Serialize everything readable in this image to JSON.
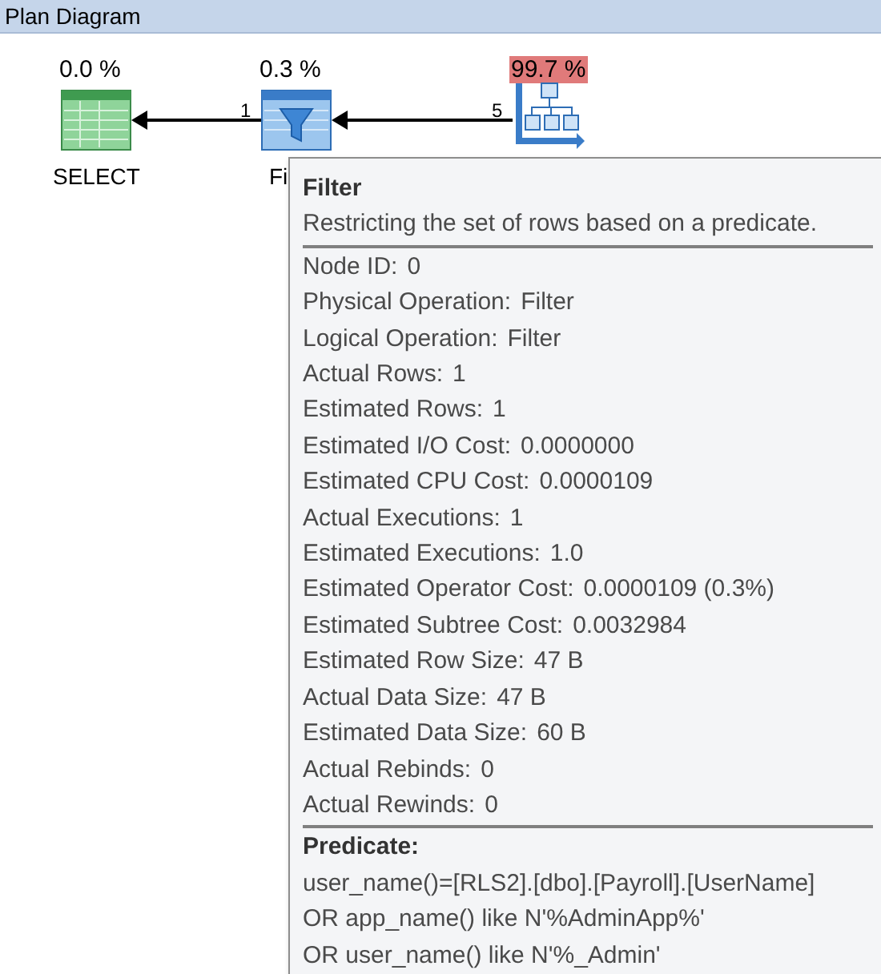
{
  "panel": {
    "title": "Plan Diagram"
  },
  "nodes": [
    {
      "kind": "select",
      "cost": "0.0 %",
      "label": "SELECT",
      "high_cost": false
    },
    {
      "kind": "filter",
      "cost": "0.3 %",
      "label": "Fi",
      "high_cost": false
    },
    {
      "kind": "tree",
      "cost": "99.7 %",
      "high_cost": true
    }
  ],
  "edges": [
    {
      "rows": "1"
    },
    {
      "rows": "5"
    }
  ],
  "tooltip": {
    "title": "Filter",
    "description": "Restricting the set of rows based on a predicate.",
    "properties": [
      {
        "label": "Node ID:",
        "value": "0"
      },
      {
        "label": "Physical Operation:",
        "value": "Filter"
      },
      {
        "label": "Logical Operation:",
        "value": "Filter"
      },
      {
        "label": "Actual Rows:",
        "value": "1"
      },
      {
        "label": "Estimated Rows:",
        "value": "1"
      },
      {
        "label": "Estimated I/O Cost:",
        "value": "0.0000000"
      },
      {
        "label": "Estimated CPU Cost:",
        "value": "0.0000109"
      },
      {
        "label": "Actual Executions:",
        "value": "1"
      },
      {
        "label": "Estimated Executions:",
        "value": "1.0"
      },
      {
        "label": "Estimated Operator Cost:",
        "value": "0.0000109 (0.3%)"
      },
      {
        "label": "Estimated Subtree Cost:",
        "value": "0.0032984"
      },
      {
        "label": "Estimated Row Size:",
        "value": "47 B"
      },
      {
        "label": "Actual Data Size:",
        "value": "47 B"
      },
      {
        "label": "Estimated Data Size:",
        "value": "60 B"
      },
      {
        "label": "Actual Rebinds:",
        "value": "0"
      },
      {
        "label": "Actual Rewinds:",
        "value": "0"
      }
    ],
    "predicate_heading": "Predicate:",
    "predicate_lines": [
      "user_name()=[RLS2].[dbo].[Payroll].[UserName]",
      "OR app_name() like N'%AdminApp%'",
      "OR user_name() like N'%_Admin'"
    ]
  }
}
